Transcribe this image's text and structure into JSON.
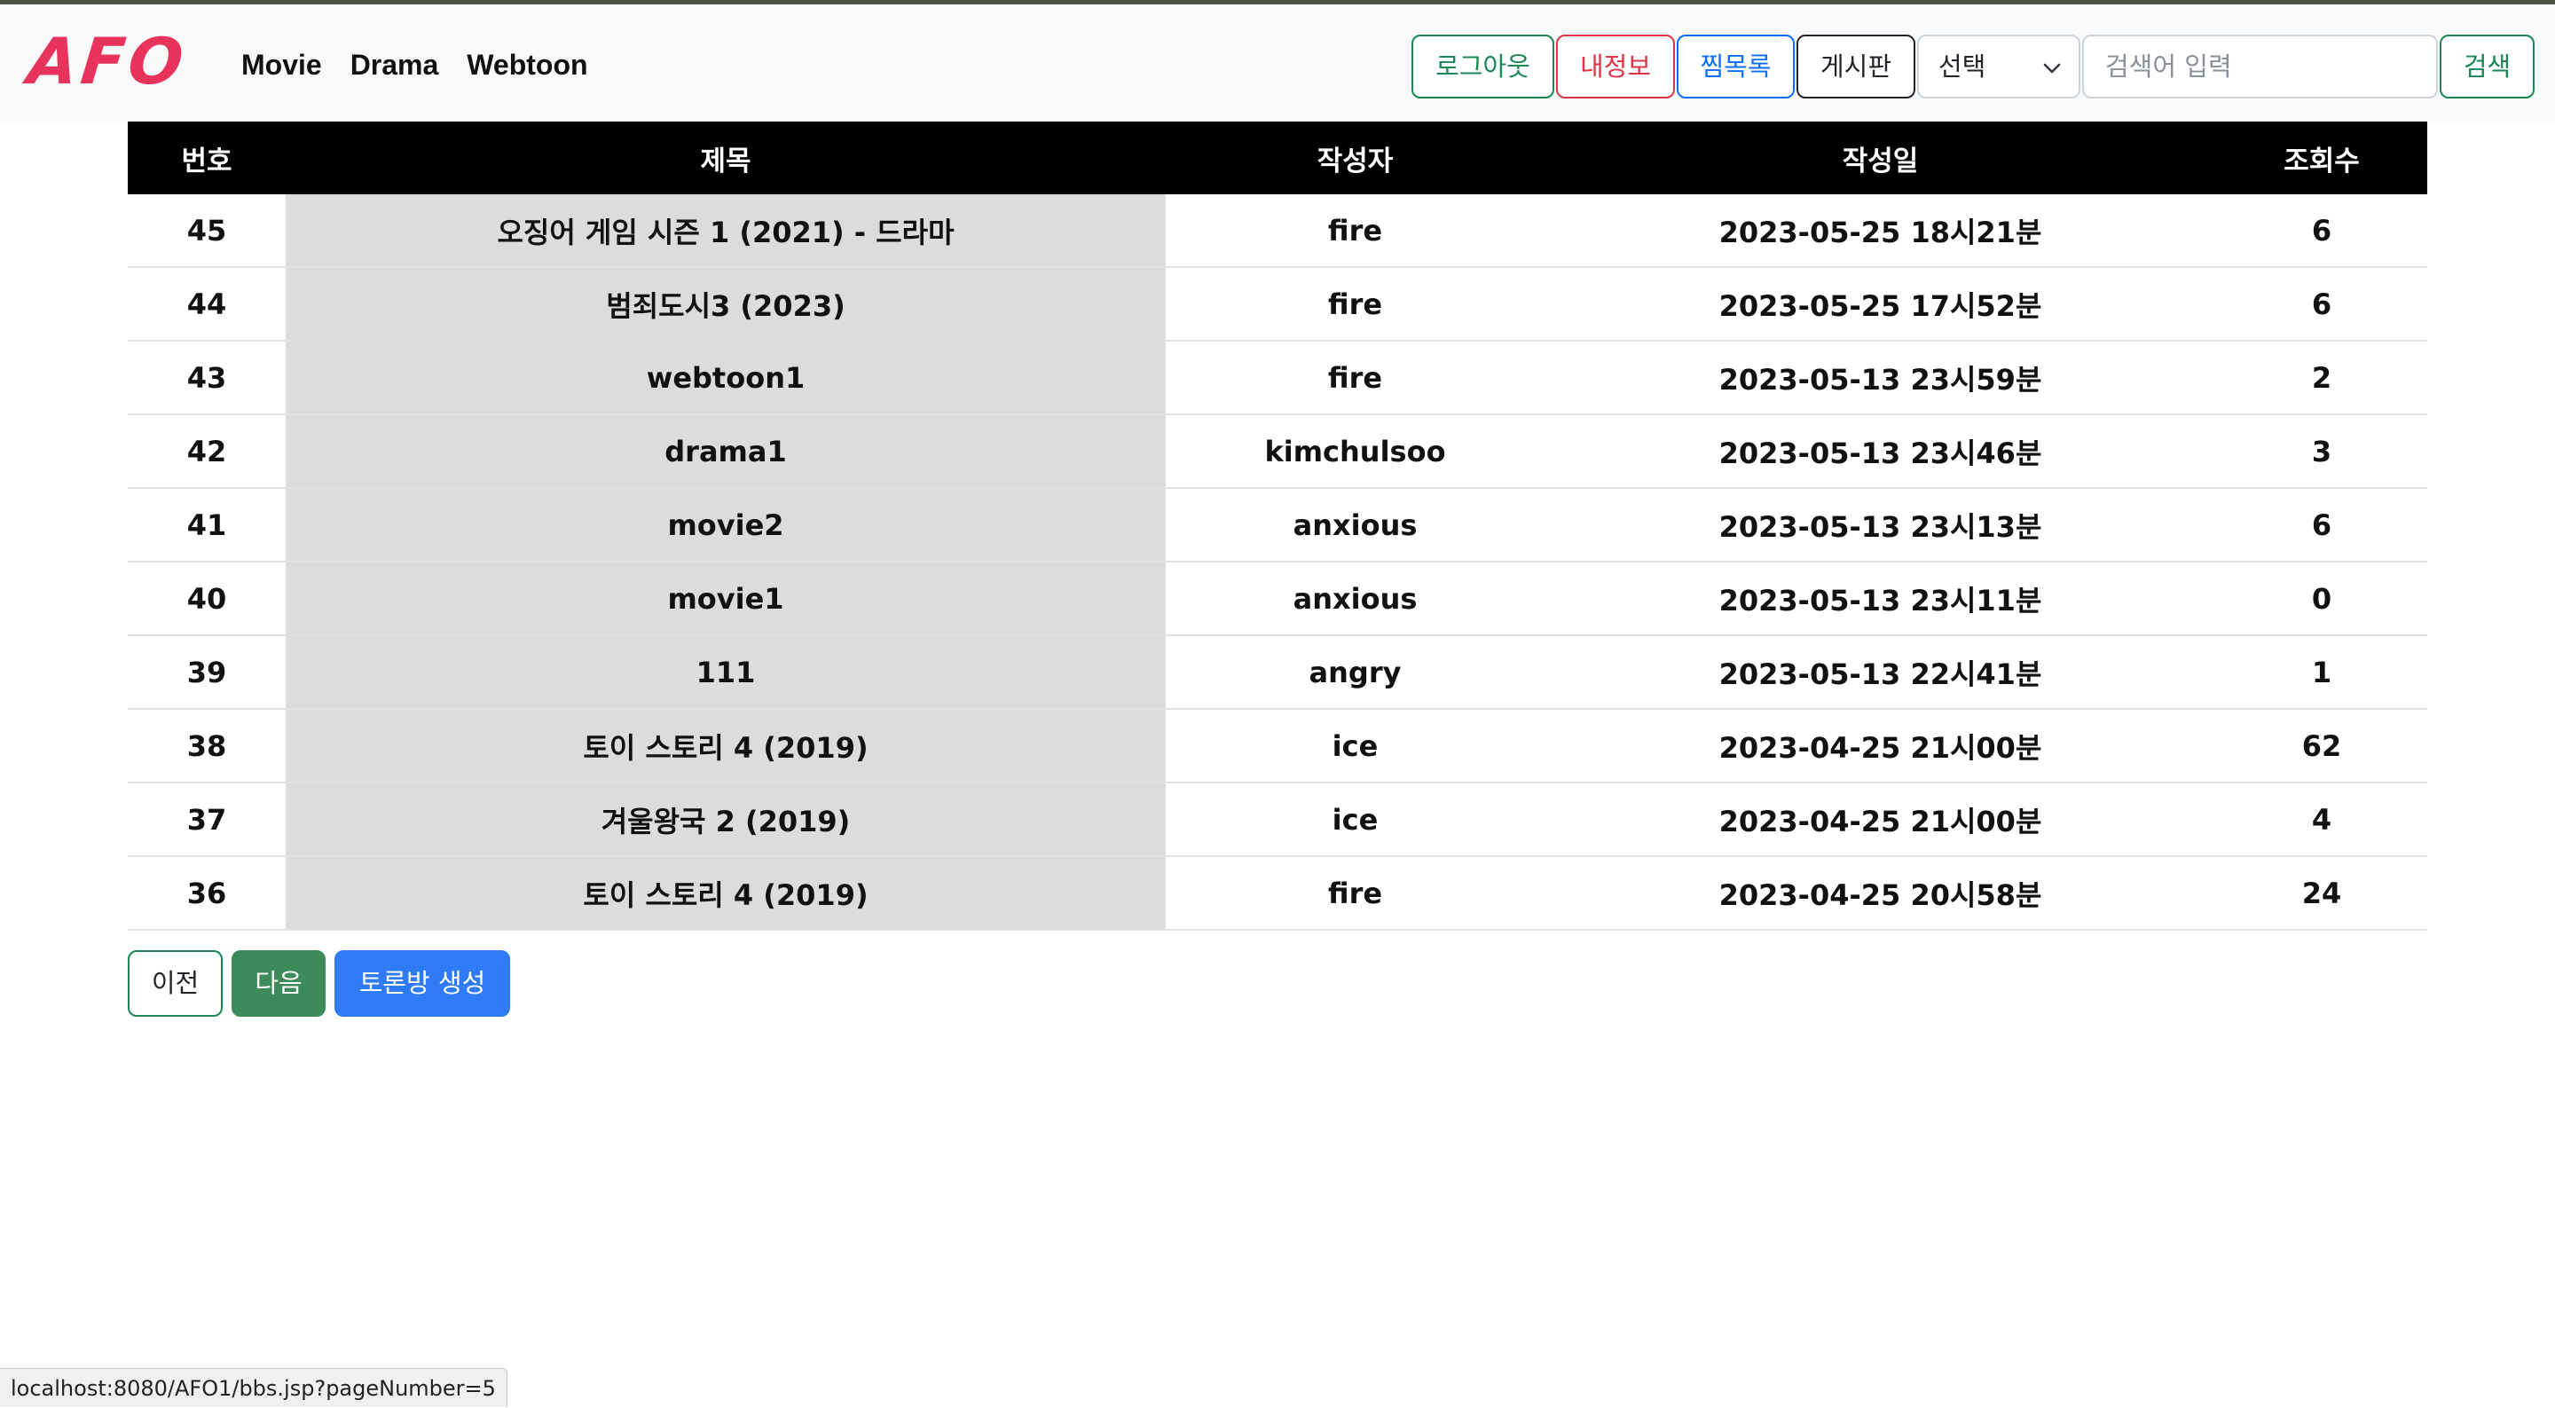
{
  "brand": {
    "logo_text": "AFO",
    "accent": "#e8335c"
  },
  "nav": {
    "links": [
      "Movie",
      "Drama",
      "Webtoon"
    ]
  },
  "toolbar": {
    "logout_label": "로그아웃",
    "myinfo_label": "내정보",
    "favorites_label": "찜목록",
    "board_label": "게시판",
    "select_value": "선택",
    "search_placeholder": "검색어 입력",
    "search_button_label": "검색"
  },
  "table": {
    "headers": [
      "번호",
      "제목",
      "작성자",
      "작성일",
      "조회수"
    ],
    "rows": [
      {
        "no": "45",
        "title": "오징어 게임 시즌 1 (2021) - 드라마",
        "author": "fire",
        "date": "2023-05-25 18시21분",
        "views": "6"
      },
      {
        "no": "44",
        "title": "범죄도시3 (2023)",
        "author": "fire",
        "date": "2023-05-25 17시52분",
        "views": "6"
      },
      {
        "no": "43",
        "title": "webtoon1",
        "author": "fire",
        "date": "2023-05-13 23시59분",
        "views": "2"
      },
      {
        "no": "42",
        "title": "drama1",
        "author": "kimchulsoo",
        "date": "2023-05-13 23시46분",
        "views": "3"
      },
      {
        "no": "41",
        "title": "movie2",
        "author": "anxious",
        "date": "2023-05-13 23시13분",
        "views": "6"
      },
      {
        "no": "40",
        "title": "movie1",
        "author": "anxious",
        "date": "2023-05-13 23시11분",
        "views": "0"
      },
      {
        "no": "39",
        "title": "111",
        "author": "angry",
        "date": "2023-05-13 22시41분",
        "views": "1"
      },
      {
        "no": "38",
        "title": "토이 스토리 4 (2019)",
        "author": "ice",
        "date": "2023-04-25 21시00분",
        "views": "62"
      },
      {
        "no": "37",
        "title": "겨울왕국 2 (2019)",
        "author": "ice",
        "date": "2023-04-25 21시00분",
        "views": "4"
      },
      {
        "no": "36",
        "title": "토이 스토리 4 (2019)",
        "author": "fire",
        "date": "2023-04-25 20시58분",
        "views": "24"
      }
    ]
  },
  "pager": {
    "prev_label": "이전",
    "next_label": "다음",
    "create_label": "토론방 생성"
  },
  "status_bar": {
    "url": "localhost:8080/AFO1/bbs.jsp?pageNumber=5"
  },
  "colors": {
    "success": "#198754",
    "danger": "#dc3545",
    "primary": "#0d6efd",
    "header_bg": "#000000",
    "title_cell_bg": "#dcdcdc"
  }
}
